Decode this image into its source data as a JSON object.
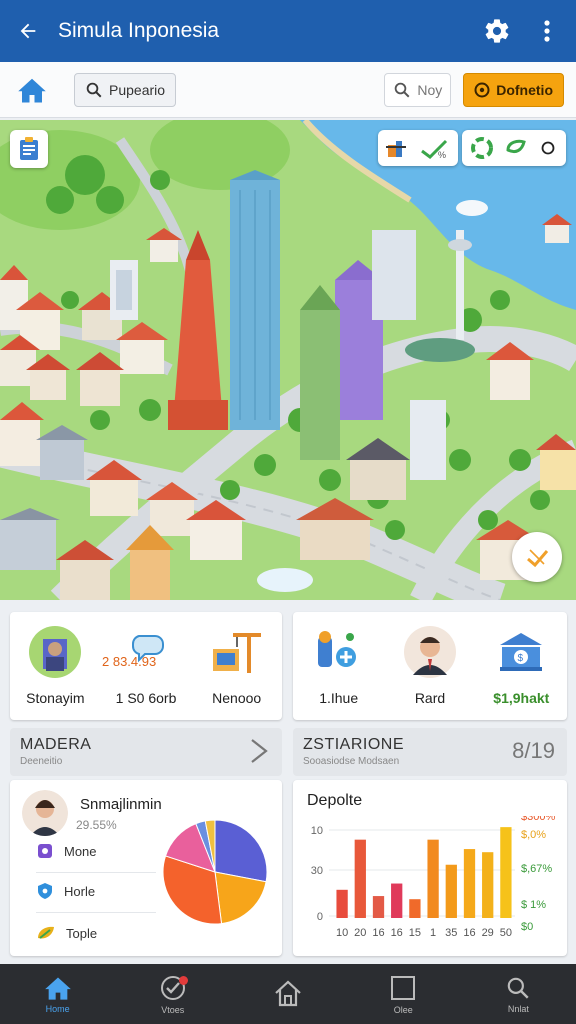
{
  "app": {
    "title": "Simula Inponesia"
  },
  "toolbar": {
    "search_label": "Pupeario",
    "nav_label": "Noy",
    "primary_label": "Dofnetio"
  },
  "stats_left": [
    {
      "label": "Stonayim",
      "icon": "city-avatar-icon"
    },
    {
      "label": "1 S0 6orb",
      "value": "2 83.4.93",
      "icon": "speech-bubble-icon"
    },
    {
      "label": "Nenooo",
      "icon": "construction-crane-icon"
    }
  ],
  "stats_right": [
    {
      "label": "1.Ihue",
      "icon": "people-network-icon"
    },
    {
      "label": "Rard",
      "icon": "businessman-avatar-icon"
    },
    {
      "label": "$1,9hakt",
      "icon": "bank-icon"
    }
  ],
  "sections": {
    "left": {
      "title": "MADERA",
      "subtitle": "Deeneitio"
    },
    "right": {
      "title": "ZSTIARIONE",
      "subtitle": "Sooasiodse Modsaen",
      "icon_text": "8/19"
    }
  },
  "profile": {
    "name": "Snmajlinmin",
    "pct": "29.55%",
    "legend": [
      {
        "label": "Mone",
        "color": "#7a4fcf",
        "icon": "gear-icon"
      },
      {
        "label": "Horle",
        "color": "#2f8fdc",
        "icon": "shield-icon"
      },
      {
        "label": "Tople",
        "color": "#e8b11a",
        "icon": "leaf-icon"
      }
    ]
  },
  "chart_data": {
    "type": "bar",
    "title": "Depolte",
    "categories": [
      "10",
      "20",
      "16",
      "16",
      "15",
      "1",
      "35",
      "16",
      "29",
      "50"
    ],
    "values": [
      90,
      250,
      70,
      110,
      60,
      250,
      170,
      220,
      210,
      290
    ],
    "y_ticks": [
      "10",
      "30",
      "0"
    ],
    "right_labels": [
      "$300%",
      "$,0%",
      "$,67%",
      "$ 1%",
      "$0"
    ],
    "bar_colors": [
      "#e84b3c",
      "#e8583a",
      "#e35a46",
      "#e03a5a",
      "#f06a2a",
      "#f28a1e",
      "#f39a1a",
      "#f5a91a",
      "#f3b11a",
      "#f6c21a"
    ]
  },
  "pie_data": {
    "values": [
      28,
      20,
      32,
      14,
      3,
      3
    ],
    "colors": [
      "#5a5fd4",
      "#f7a51a",
      "#f4622c",
      "#e9609c",
      "#6a8fe0",
      "#f0c040"
    ]
  },
  "bottom_nav": [
    {
      "label": "Home",
      "icon": "home-icon",
      "active": true
    },
    {
      "label": "Vtoes",
      "icon": "checkmark-badge-icon",
      "active": false
    },
    {
      "label": "",
      "icon": "house-outline-icon",
      "active": false
    },
    {
      "label": "Olee",
      "icon": "square-icon",
      "active": false
    },
    {
      "label": "Nnlat",
      "icon": "search-icon",
      "active": false
    }
  ]
}
